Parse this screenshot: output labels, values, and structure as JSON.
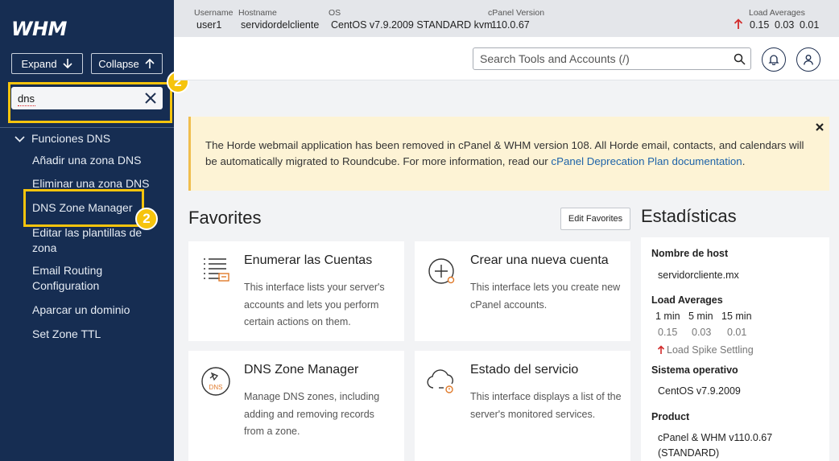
{
  "sidebar": {
    "logo": "WHM",
    "expand_label": "Expand",
    "collapse_label": "Collapse",
    "search_value": "dns",
    "badge": "2",
    "category": "Funciones DNS",
    "items": [
      {
        "label": "Añadir una zona DNS"
      },
      {
        "label": "Eliminar una zona DNS"
      },
      {
        "label": "DNS Zone Manager"
      },
      {
        "label": "Editar las plantillas de zona"
      },
      {
        "label": "Email Routing Configuration"
      },
      {
        "label": "Aparcar un dominio"
      },
      {
        "label": "Set Zone TTL"
      }
    ]
  },
  "topbar": {
    "username_label": "Username",
    "username": "user1",
    "hostname_label": "Hostname",
    "hostname": "servidordelcliente",
    "os_label": "OS",
    "os": "CentOS v7.9.2009 STANDARD kvm",
    "version_label": "cPanel Version",
    "version": "110.0.67",
    "load_label": "Load Averages",
    "load": [
      "0.15",
      "0.03",
      "0.01"
    ]
  },
  "header": {
    "search_placeholder": "Search Tools and Accounts (/)"
  },
  "notice": {
    "text": "The Horde webmail application has been removed in cPanel & WHM version 108. All Horde email, contacts, and calendars will be automatically migrated to Roundcube. For more information, read our ",
    "link": "cPanel Deprecation Plan documentation",
    "end": "."
  },
  "favorites": {
    "title": "Favorites",
    "edit_label": "Edit Favorites",
    "cards": [
      {
        "title": "Enumerar las Cuentas",
        "desc": "This interface lists your server's accounts and lets you perform certain actions on them."
      },
      {
        "title": "Crear una nueva cuenta",
        "desc": "This interface lets you create new cPanel accounts."
      },
      {
        "title": "DNS Zone Manager",
        "desc": "Manage DNS zones, including adding and removing records from a zone.",
        "icon_text": "DNS"
      },
      {
        "title": "Estado del servicio",
        "desc": "This interface displays a list of the server's monitored services."
      }
    ]
  },
  "stats": {
    "title": "Estadísticas",
    "hostname_label": "Nombre de host",
    "hostname": "servidorcliente.mx",
    "load_label": "Load Averages",
    "periods": [
      "1 min",
      "5 min",
      "15 min"
    ],
    "values": [
      "0.15",
      "0.03",
      "0.01"
    ],
    "spike": "Load Spike Settling",
    "os_label": "Sistema operativo",
    "os": "CentOS v7.9.2009",
    "product_label": "Product",
    "product": "cPanel & WHM v110.0.67 (STANDARD)"
  },
  "colors": {
    "sidebar_bg": "#162d52",
    "highlight": "#f6c40d",
    "notice_bg": "#fdf3d5",
    "link": "#1e63a8",
    "load_up": "#d22b2b"
  }
}
